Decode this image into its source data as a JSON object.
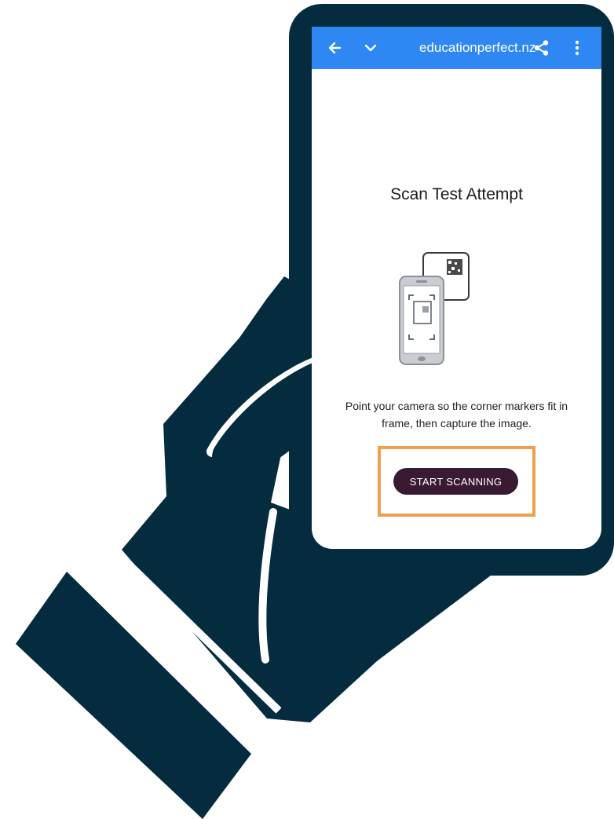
{
  "browser": {
    "url": "educationperfect.nz",
    "back_icon": "arrow-left-icon",
    "collapse_icon": "chevron-down-icon",
    "share_icon": "share-icon",
    "menu_icon": "more-vertical-icon",
    "bar_color": "#2f87f3"
  },
  "screen": {
    "title": "Scan Test Attempt",
    "illustration_icon": "phone-scanning-qr-illustration",
    "instructions_line1": "Point your camera so the corner markers fit in",
    "instructions_line2": "frame, then capture the image.",
    "button_label": "START SCANNING",
    "button_color": "#3a1a32",
    "highlight_color": "#f0a04b"
  },
  "illustration": {
    "hand_icon": "hand-holding-phone-illustration",
    "silhouette_color": "#052c3e"
  }
}
